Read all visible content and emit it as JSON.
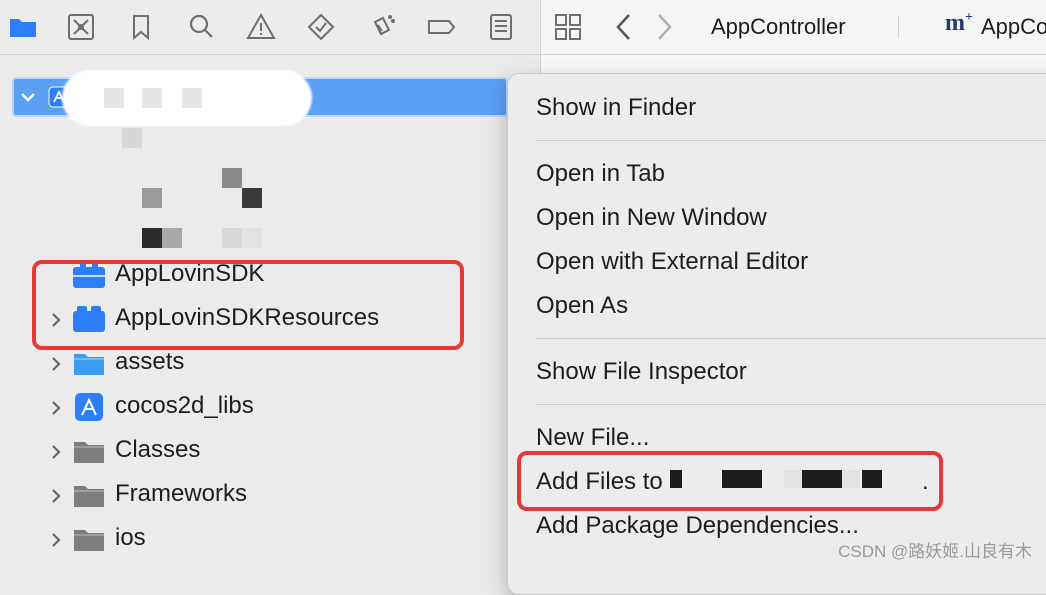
{
  "toolbar": {
    "icons": [
      "folder-icon",
      "source-control-icon",
      "bookmark-icon",
      "search-icon",
      "warning-icon",
      "test-icon",
      "debug-icon",
      "breakpoint-icon",
      "report-icon"
    ]
  },
  "project": {
    "name": ""
  },
  "tree": {
    "items": [
      {
        "label": "AppLovinSDK",
        "icon": "framework-icon",
        "disclosure": false
      },
      {
        "label": "AppLovinSDKResources",
        "icon": "bundle-icon",
        "disclosure": true
      },
      {
        "label": "assets",
        "icon": "folder-icon",
        "disclosure": true
      },
      {
        "label": "cocos2d_libs",
        "icon": "xcodeproj-icon",
        "disclosure": true
      },
      {
        "label": "Classes",
        "icon": "folder-icon",
        "disclosure": true
      },
      {
        "label": "Frameworks",
        "icon": "folder-icon",
        "disclosure": true
      },
      {
        "label": "ios",
        "icon": "folder-icon",
        "disclosure": true
      }
    ]
  },
  "editor": {
    "tab_1": "AppController",
    "tab_2_prefix": "m",
    "tab_2_suffix": "+",
    "tab_2": "AppCo"
  },
  "context_menu": {
    "items": [
      "Show in Finder",
      "Open in Tab",
      "Open in New Window",
      "Open with External Editor",
      "Open As",
      "Show File Inspector",
      "New File...",
      "Add Files to",
      "Add Package Dependencies..."
    ],
    "add_files_suffix": "."
  },
  "colors": {
    "selection": "#5aa0f5",
    "highlight": "#e53935",
    "icon_blue": "#2d7ff9"
  },
  "watermark": "CSDN @路妖姬.山良有木"
}
